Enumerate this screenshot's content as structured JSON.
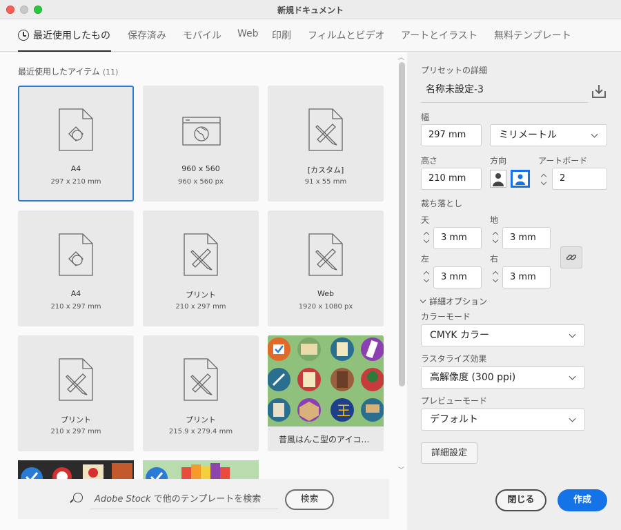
{
  "window": {
    "title": "新規ドキュメント"
  },
  "tabs": [
    {
      "label": "最近使用したもの"
    },
    {
      "label": "保存済み"
    },
    {
      "label": "モバイル"
    },
    {
      "label": "Web"
    },
    {
      "label": "印刷"
    },
    {
      "label": "フィルムとビデオ"
    },
    {
      "label": "アートとイラスト"
    },
    {
      "label": "無料テンプレート"
    }
  ],
  "recent": {
    "title": "最近使用したアイテム",
    "count": "(11)",
    "items": [
      {
        "name": "A4",
        "dims": "297 x 210 mm",
        "icon": "shapes-document-icon"
      },
      {
        "name": "960 x 560",
        "dims": "960 x 560 px",
        "icon": "web-globe-icon"
      },
      {
        "name": "[カスタム]",
        "dims": "91 x 55 mm",
        "icon": "pencil-ruler-document-icon"
      },
      {
        "name": "A4",
        "dims": "210 x 297 mm",
        "icon": "shapes-document-icon"
      },
      {
        "name": "プリント",
        "dims": "210 x 297 mm",
        "icon": "pencil-ruler-document-icon"
      },
      {
        "name": "Web",
        "dims": "1920 x 1080 px",
        "icon": "pencil-ruler-document-icon"
      },
      {
        "name": "プリント",
        "dims": "210 x 297 mm",
        "icon": "pencil-ruler-document-icon"
      },
      {
        "name": "プリント",
        "dims": "215.9 x 279.4 mm",
        "icon": "pencil-ruler-document-icon"
      },
      {
        "name": "昔風はんこ型のアイコ…",
        "dims": "",
        "icon": "template-thumbnail"
      }
    ]
  },
  "search": {
    "brand": "Adobe Stock",
    "placeholder_rest": " で他のテンプレートを検索",
    "button": "検索"
  },
  "preset": {
    "section_label": "プリセットの詳細",
    "name": "名称未設定-3",
    "width_label": "幅",
    "width_value": "297 mm",
    "unit": "ミリメートル",
    "height_label": "高さ",
    "height_value": "210 mm",
    "orientation_label": "方向",
    "artboards_label": "アートボード",
    "artboards_value": "2",
    "bleed_label": "裁ち落とし",
    "bleed_top_label": "天",
    "bleed_top": "3 mm",
    "bleed_bottom_label": "地",
    "bleed_bottom": "3 mm",
    "bleed_left_label": "左",
    "bleed_left": "3 mm",
    "bleed_right_label": "右",
    "bleed_right": "3 mm",
    "advanced_toggle": "詳細オプション",
    "color_mode_label": "カラーモード",
    "color_mode": "CMYK カラー",
    "raster_label": "ラスタライズ効果",
    "raster": "高解像度 (300 ppi)",
    "preview_label": "プレビューモード",
    "preview": "デフォルト",
    "more_settings": "詳細設定"
  },
  "actions": {
    "close": "閉じる",
    "create": "作成"
  },
  "colors": {
    "accent": "#2a7bd5",
    "create_button": "#1473e6"
  }
}
